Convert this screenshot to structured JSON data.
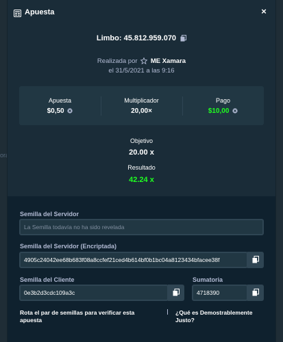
{
  "background": {
    "left_fragment": "ora"
  },
  "modal": {
    "title": "Apuesta",
    "title_icon": "receipt-icon",
    "close_label": "×",
    "game_line": "Limbo: 45.812.959.070",
    "placed_prefix": "Realizada por",
    "user": "ME Xamara",
    "date": "el 31/5/2021 a las 9:16",
    "stats": [
      {
        "label": "Apuesta",
        "value": "$0,50"
      },
      {
        "label": "Multiplicador",
        "value": "20,00×"
      },
      {
        "label": "Pago",
        "value": "$10,00"
      }
    ],
    "target_label": "Objetivo",
    "target_value": "20.00 x",
    "result_label": "Resultado",
    "result_value": "42.24 x"
  },
  "fairness": {
    "server_seed_label": "Semilla del Servidor",
    "server_seed_value": "La Semilla todavía no ha sido revelada",
    "server_seed_hashed_label": "Semilla del Servidor (Encriptada)",
    "server_seed_hashed_value": "4905c24042ee68b683f08a8ccfef21ced4b614bf0b1bc04a8123434bfacee38f",
    "client_seed_label": "Semilla del Cliente",
    "client_seed_value": "0e3b2d3cdc109a3c",
    "nonce_label": "Sumatoria",
    "nonce_value": "4718390",
    "rotate_link": "Rota el par de semillas para verificar esta apuesta",
    "provably_fair_link": "¿Qué es Demostrablemente Justo?"
  },
  "colors": {
    "accent_green": "#1fff20",
    "panel": "#1a2c38",
    "field": "#213743"
  }
}
